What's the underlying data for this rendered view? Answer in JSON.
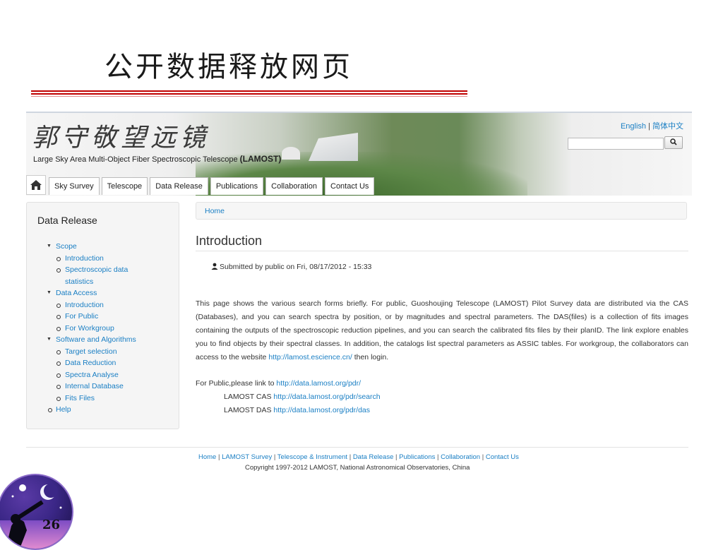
{
  "slide": {
    "title": "公开数据释放网页",
    "page_number": "26"
  },
  "site": {
    "logo_cn": "郭守敬望远镜",
    "logo_en_prefix": "Large Sky Area Multi-Object Fiber Spectroscopic Telescope ",
    "logo_en_bold": "(LAMOST)",
    "lang_en": "English",
    "lang_sep": " | ",
    "lang_cn": "简体中文",
    "search_placeholder": "",
    "search_icon": "magnifier-icon",
    "nav": {
      "home_icon": "house-icon",
      "tabs": [
        "Sky Survey",
        "Telescope",
        "Data Release",
        "Publications",
        "Collaboration",
        "Contact Us"
      ]
    }
  },
  "sidebar": {
    "title": "Data Release",
    "groups": [
      {
        "label": "Scope",
        "items": [
          "Introduction",
          "Spectroscopic data",
          "statistics"
        ]
      },
      {
        "label": "Data Access",
        "items": [
          "Introduction",
          "For Public",
          "For Workgroup"
        ]
      },
      {
        "label": "Software and Algorithms",
        "items": [
          "Target selection",
          "Data Reduction",
          "Spectra Analyse",
          "Internal Database",
          "Fits Files"
        ]
      }
    ],
    "help": "Help"
  },
  "main": {
    "breadcrumb": "Home",
    "heading": "Introduction",
    "submitted": "Submitted by public on Fri, 08/17/2012 - 15:33",
    "intro_text": "This page shows the various search forms briefly. For public, Guoshoujing Telescope (LAMOST) Pilot Survey data are distributed via the CAS (Databases), and you can search spectra by position, or by magnitudes and spectral parameters. The DAS(files) is a collection of fits images containing the outputs of the spectroscopic reduction pipelines, and you can search the calibrated fits files by their planID. The link explore enables you to find objects by their spectral classes. In addition, the catalogs list spectral parameters as ASSIC tables. For workgroup, the collaborators can access to the website ",
    "intro_link": "http://lamost.escience.cn/",
    "intro_tail": " then login.",
    "public_label": "For Public,please link to ",
    "public_link": "http://data.lamost.org/pdr/",
    "cas_label": "LAMOST CAS ",
    "cas_link": "http://data.lamost.org/pdr/search",
    "das_label": "LAMOST DAS ",
    "das_link": "http://data.lamost.org/pdr/das"
  },
  "footer": {
    "links": [
      "Home",
      "LAMOST Survey",
      "Telescope & Instrument",
      "Data Release",
      "Publications",
      "Collaboration",
      "Contact Us"
    ],
    "sep": " | ",
    "copyright": "Copyright 1997-2012 LAMOST, National Astronomical Observatories, China"
  },
  "colors": {
    "link": "#1a7fc4",
    "title_rule": "#c00000"
  }
}
